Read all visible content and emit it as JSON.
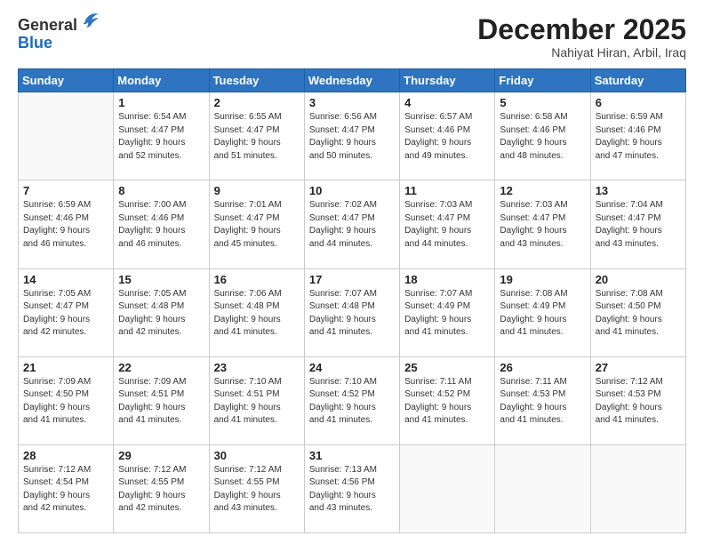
{
  "header": {
    "logo_line1": "General",
    "logo_line2": "Blue",
    "month_title": "December 2025",
    "subtitle": "Nahiyat Hiran, Arbil, Iraq"
  },
  "days_of_week": [
    "Sunday",
    "Monday",
    "Tuesday",
    "Wednesday",
    "Thursday",
    "Friday",
    "Saturday"
  ],
  "weeks": [
    [
      {
        "day": "",
        "sunrise": "",
        "sunset": "",
        "daylight": ""
      },
      {
        "day": "1",
        "sunrise": "Sunrise: 6:54 AM",
        "sunset": "Sunset: 4:47 PM",
        "daylight": "Daylight: 9 hours and 52 minutes."
      },
      {
        "day": "2",
        "sunrise": "Sunrise: 6:55 AM",
        "sunset": "Sunset: 4:47 PM",
        "daylight": "Daylight: 9 hours and 51 minutes."
      },
      {
        "day": "3",
        "sunrise": "Sunrise: 6:56 AM",
        "sunset": "Sunset: 4:47 PM",
        "daylight": "Daylight: 9 hours and 50 minutes."
      },
      {
        "day": "4",
        "sunrise": "Sunrise: 6:57 AM",
        "sunset": "Sunset: 4:46 PM",
        "daylight": "Daylight: 9 hours and 49 minutes."
      },
      {
        "day": "5",
        "sunrise": "Sunrise: 6:58 AM",
        "sunset": "Sunset: 4:46 PM",
        "daylight": "Daylight: 9 hours and 48 minutes."
      },
      {
        "day": "6",
        "sunrise": "Sunrise: 6:59 AM",
        "sunset": "Sunset: 4:46 PM",
        "daylight": "Daylight: 9 hours and 47 minutes."
      }
    ],
    [
      {
        "day": "7",
        "sunrise": "Sunrise: 6:59 AM",
        "sunset": "Sunset: 4:46 PM",
        "daylight": "Daylight: 9 hours and 46 minutes."
      },
      {
        "day": "8",
        "sunrise": "Sunrise: 7:00 AM",
        "sunset": "Sunset: 4:46 PM",
        "daylight": "Daylight: 9 hours and 46 minutes."
      },
      {
        "day": "9",
        "sunrise": "Sunrise: 7:01 AM",
        "sunset": "Sunset: 4:47 PM",
        "daylight": "Daylight: 9 hours and 45 minutes."
      },
      {
        "day": "10",
        "sunrise": "Sunrise: 7:02 AM",
        "sunset": "Sunset: 4:47 PM",
        "daylight": "Daylight: 9 hours and 44 minutes."
      },
      {
        "day": "11",
        "sunrise": "Sunrise: 7:03 AM",
        "sunset": "Sunset: 4:47 PM",
        "daylight": "Daylight: 9 hours and 44 minutes."
      },
      {
        "day": "12",
        "sunrise": "Sunrise: 7:03 AM",
        "sunset": "Sunset: 4:47 PM",
        "daylight": "Daylight: 9 hours and 43 minutes."
      },
      {
        "day": "13",
        "sunrise": "Sunrise: 7:04 AM",
        "sunset": "Sunset: 4:47 PM",
        "daylight": "Daylight: 9 hours and 43 minutes."
      }
    ],
    [
      {
        "day": "14",
        "sunrise": "Sunrise: 7:05 AM",
        "sunset": "Sunset: 4:47 PM",
        "daylight": "Daylight: 9 hours and 42 minutes."
      },
      {
        "day": "15",
        "sunrise": "Sunrise: 7:05 AM",
        "sunset": "Sunset: 4:48 PM",
        "daylight": "Daylight: 9 hours and 42 minutes."
      },
      {
        "day": "16",
        "sunrise": "Sunrise: 7:06 AM",
        "sunset": "Sunset: 4:48 PM",
        "daylight": "Daylight: 9 hours and 41 minutes."
      },
      {
        "day": "17",
        "sunrise": "Sunrise: 7:07 AM",
        "sunset": "Sunset: 4:48 PM",
        "daylight": "Daylight: 9 hours and 41 minutes."
      },
      {
        "day": "18",
        "sunrise": "Sunrise: 7:07 AM",
        "sunset": "Sunset: 4:49 PM",
        "daylight": "Daylight: 9 hours and 41 minutes."
      },
      {
        "day": "19",
        "sunrise": "Sunrise: 7:08 AM",
        "sunset": "Sunset: 4:49 PM",
        "daylight": "Daylight: 9 hours and 41 minutes."
      },
      {
        "day": "20",
        "sunrise": "Sunrise: 7:08 AM",
        "sunset": "Sunset: 4:50 PM",
        "daylight": "Daylight: 9 hours and 41 minutes."
      }
    ],
    [
      {
        "day": "21",
        "sunrise": "Sunrise: 7:09 AM",
        "sunset": "Sunset: 4:50 PM",
        "daylight": "Daylight: 9 hours and 41 minutes."
      },
      {
        "day": "22",
        "sunrise": "Sunrise: 7:09 AM",
        "sunset": "Sunset: 4:51 PM",
        "daylight": "Daylight: 9 hours and 41 minutes."
      },
      {
        "day": "23",
        "sunrise": "Sunrise: 7:10 AM",
        "sunset": "Sunset: 4:51 PM",
        "daylight": "Daylight: 9 hours and 41 minutes."
      },
      {
        "day": "24",
        "sunrise": "Sunrise: 7:10 AM",
        "sunset": "Sunset: 4:52 PM",
        "daylight": "Daylight: 9 hours and 41 minutes."
      },
      {
        "day": "25",
        "sunrise": "Sunrise: 7:11 AM",
        "sunset": "Sunset: 4:52 PM",
        "daylight": "Daylight: 9 hours and 41 minutes."
      },
      {
        "day": "26",
        "sunrise": "Sunrise: 7:11 AM",
        "sunset": "Sunset: 4:53 PM",
        "daylight": "Daylight: 9 hours and 41 minutes."
      },
      {
        "day": "27",
        "sunrise": "Sunrise: 7:12 AM",
        "sunset": "Sunset: 4:53 PM",
        "daylight": "Daylight: 9 hours and 41 minutes."
      }
    ],
    [
      {
        "day": "28",
        "sunrise": "Sunrise: 7:12 AM",
        "sunset": "Sunset: 4:54 PM",
        "daylight": "Daylight: 9 hours and 42 minutes."
      },
      {
        "day": "29",
        "sunrise": "Sunrise: 7:12 AM",
        "sunset": "Sunset: 4:55 PM",
        "daylight": "Daylight: 9 hours and 42 minutes."
      },
      {
        "day": "30",
        "sunrise": "Sunrise: 7:12 AM",
        "sunset": "Sunset: 4:55 PM",
        "daylight": "Daylight: 9 hours and 43 minutes."
      },
      {
        "day": "31",
        "sunrise": "Sunrise: 7:13 AM",
        "sunset": "Sunset: 4:56 PM",
        "daylight": "Daylight: 9 hours and 43 minutes."
      },
      {
        "day": "",
        "sunrise": "",
        "sunset": "",
        "daylight": ""
      },
      {
        "day": "",
        "sunrise": "",
        "sunset": "",
        "daylight": ""
      },
      {
        "day": "",
        "sunrise": "",
        "sunset": "",
        "daylight": ""
      }
    ]
  ]
}
